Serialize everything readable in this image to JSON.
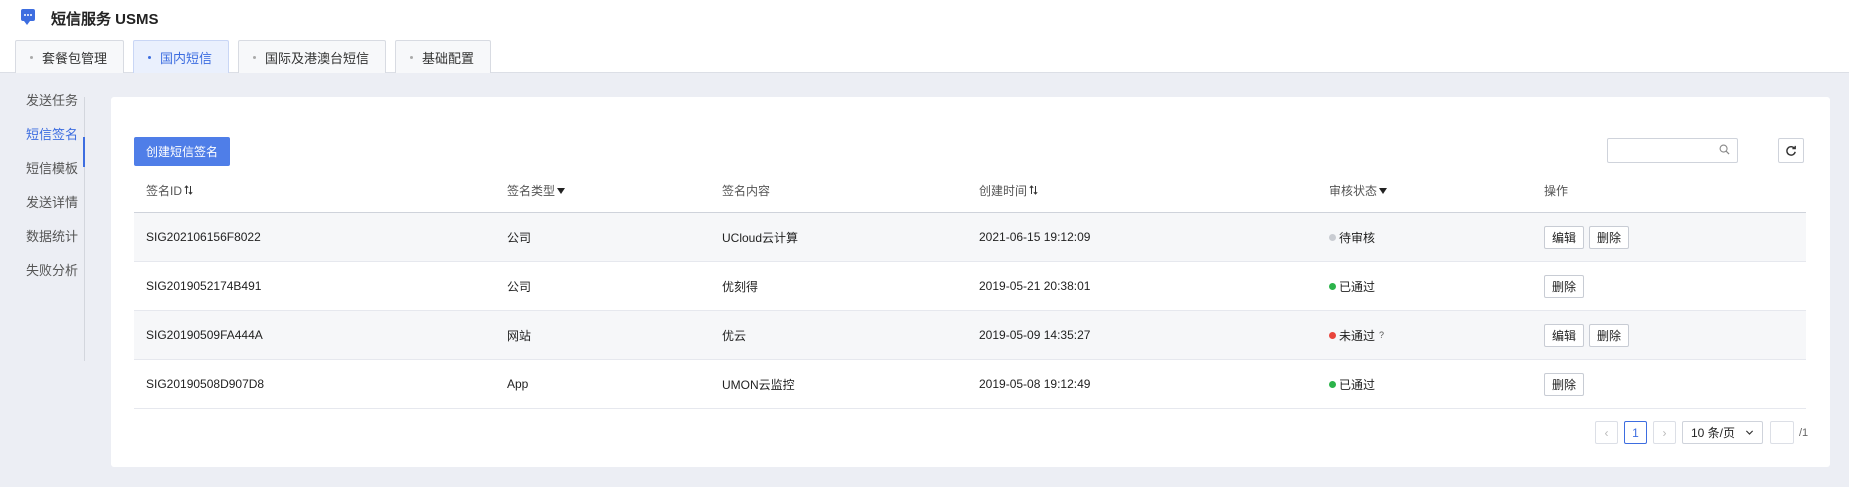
{
  "app": {
    "title": "短信服务 USMS"
  },
  "tabs": [
    {
      "label": "套餐包管理",
      "active": false
    },
    {
      "label": "国内短信",
      "active": true
    },
    {
      "label": "国际及港澳台短信",
      "active": false
    },
    {
      "label": "基础配置",
      "active": false
    }
  ],
  "sidebar": {
    "items": [
      {
        "label": "发送任务"
      },
      {
        "label": "短信签名",
        "active": true
      },
      {
        "label": "短信模板"
      },
      {
        "label": "发送详情"
      },
      {
        "label": "数据统计"
      },
      {
        "label": "失败分析"
      }
    ]
  },
  "toolbar": {
    "create_label": "创建短信签名",
    "search_placeholder": ""
  },
  "table": {
    "headers": {
      "id": "签名ID",
      "type": "签名类型",
      "content": "签名内容",
      "created": "创建时间",
      "status": "审核状态",
      "ops": "操作"
    },
    "rows": [
      {
        "id": "SIG202106156F8022",
        "type": "公司",
        "content": "UCloud云计算",
        "created": "2021-06-15 19:12:09",
        "status": "待审核",
        "status_color": "#c9ccd2",
        "edit": "编辑",
        "delete": "删除"
      },
      {
        "id": "SIG2019052174B491",
        "type": "公司",
        "content": "优刻得",
        "created": "2019-05-21 20:38:01",
        "status": "已通过",
        "status_color": "#2bb34a",
        "delete": "删除"
      },
      {
        "id": "SIG20190509FA444A",
        "type": "网站",
        "content": "优云",
        "created": "2019-05-09 14:35:27",
        "status": "未通过",
        "status_color": "#e8453c",
        "status_hint": "?",
        "edit": "编辑",
        "delete": "删除"
      },
      {
        "id": "SIG20190508D907D8",
        "type": "App",
        "content": "UMON云监控",
        "created": "2019-05-08 19:12:49",
        "status": "已通过",
        "status_color": "#2bb34a",
        "delete": "删除"
      }
    ]
  },
  "pagination": {
    "current_page": "1",
    "page_size": "10 条/页",
    "total_pages": "/1"
  },
  "colors": {
    "accent": "#3d6de0",
    "button": "#4f7ee8"
  }
}
